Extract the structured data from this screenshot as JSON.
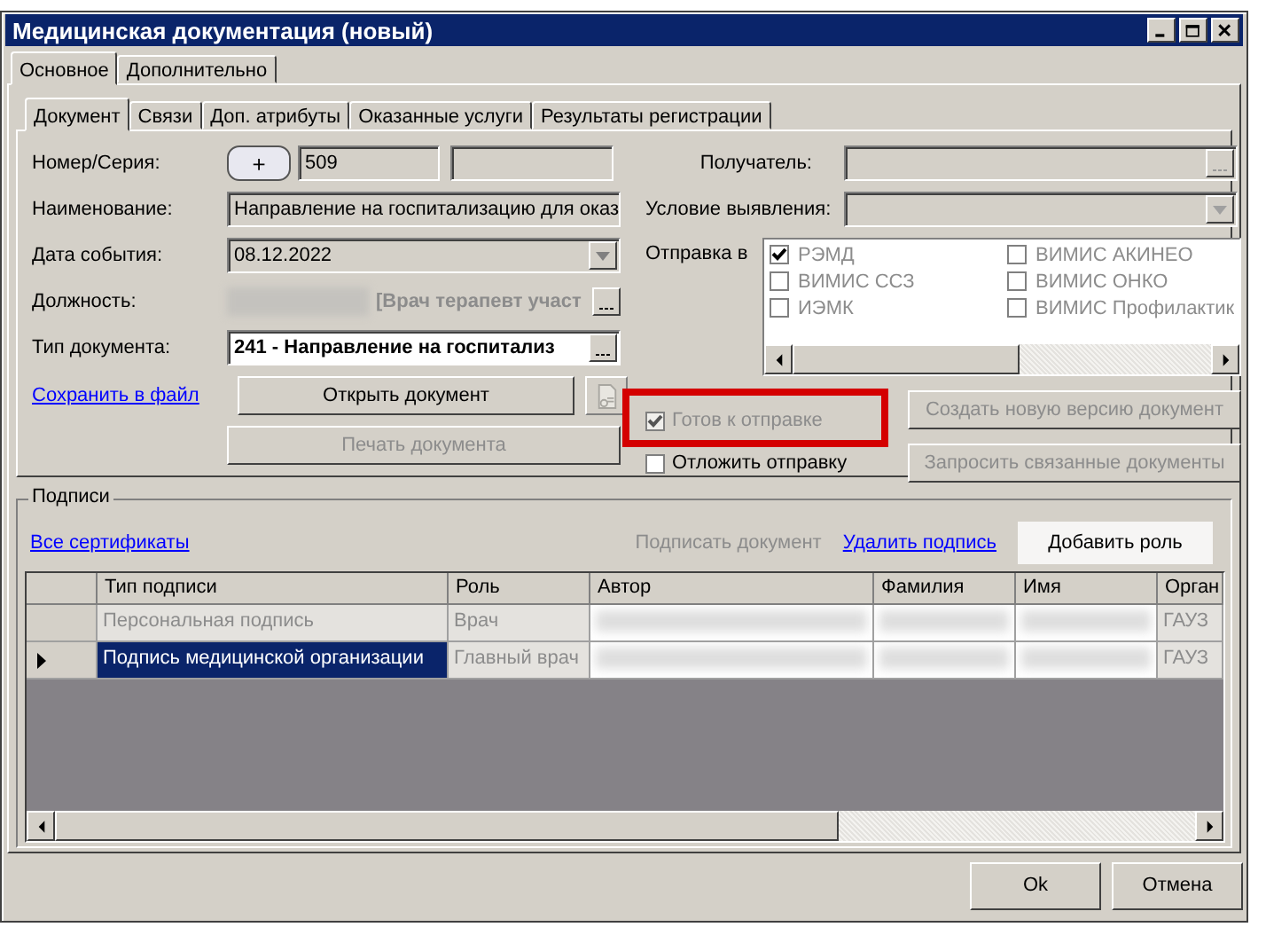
{
  "window": {
    "title": "Медицинская документация (новый)"
  },
  "outer_tabs": [
    {
      "label": "Основное",
      "selected": true
    },
    {
      "label": "Дополнительно",
      "selected": false
    }
  ],
  "inner_tabs": [
    {
      "label": "Документ",
      "selected": true
    },
    {
      "label": "Связи",
      "selected": false
    },
    {
      "label": "Доп. атрибуты",
      "selected": false
    },
    {
      "label": "Оказанные услуги",
      "selected": false
    },
    {
      "label": "Результаты регистрации",
      "selected": false
    }
  ],
  "document": {
    "number_label": "Номер/Серия:",
    "add_button": "+",
    "number": "509",
    "name_label": "Наименование:",
    "name": "Направление на госпитализацию для оказ",
    "date_label": "Дата события:",
    "date": "08.12.2022",
    "position_label": "Должность:",
    "position": "[Врач терапевт участ",
    "doctype_label": "Тип документа:",
    "doctype": "241 - Направление на госпитализ",
    "save_link": "Сохранить в файл",
    "open_button": "Открыть документ",
    "print_button": {
      "label": "Печать документа",
      "disabled": true
    }
  },
  "recipient_label": "Получатель:",
  "condition_label": "Условие выявления:",
  "send_label": "Отправка в",
  "send_targets": [
    {
      "label": "РЭМД",
      "checked": true
    },
    {
      "label": "ВИМИС АКИНЕО",
      "checked": false
    },
    {
      "label": "ВИМИС ССЗ",
      "checked": false
    },
    {
      "label": "ВИМИС ОНКО",
      "checked": false
    },
    {
      "label": "ИЭМК",
      "checked": false
    },
    {
      "label": "ВИМИС Профилактик",
      "checked": false
    }
  ],
  "send_options": [
    {
      "label": "Готов к отправке",
      "checked": true,
      "disabled": true,
      "highlighted": true
    },
    {
      "label": "Отложить отправку",
      "checked": false,
      "disabled": false,
      "highlighted": false
    }
  ],
  "version_buttons": [
    {
      "label": "Создать  новую  версию документ",
      "disabled": true
    },
    {
      "label": "Запросить связанные документы",
      "disabled": true
    }
  ],
  "signatures": {
    "title": "Подписи",
    "all_certs_link": "Все сертификаты",
    "sign_button": {
      "label": "Подписать документ",
      "disabled": true
    },
    "delete_link": "Удалить подпись",
    "add_role_button": "Добавить роль",
    "columns": [
      "Тип подписи",
      "Роль",
      "Автор",
      "Фамилия",
      "Имя",
      "Орган"
    ],
    "rows": [
      {
        "selected": false,
        "type": "Персональная подпись",
        "role": "Врач",
        "org": "ГАУЗ"
      },
      {
        "selected": true,
        "type": "Подпись медицинской организации",
        "role": "Главный врач",
        "org": "ГАУЗ"
      }
    ]
  },
  "buttons": [
    "Ok",
    "Отмена"
  ]
}
